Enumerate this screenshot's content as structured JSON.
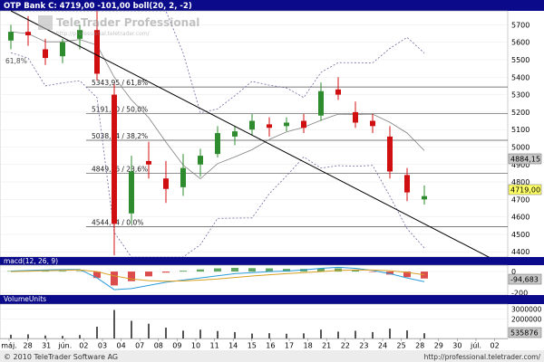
{
  "header": {
    "price_title": "OTP Bank C: 4719,00 -101,00 boll(20, 2, -2)",
    "macd_title": "macd(12, 26, 9)",
    "volume_title": "VolumeUnits"
  },
  "watermark": {
    "brand": "TeleTrader Professional",
    "url": "http://professional.teletrader.com/"
  },
  "footer": {
    "copyright": "© 2010 TeleTrader Software AG",
    "url": "http://professional.teletrader.com/"
  },
  "badges": {
    "upper_band": "4884,15",
    "last_price": "4719,00",
    "macd_value": "-94,683",
    "volume_value": "535876"
  },
  "colors": {
    "up_candle": "#2e8b2e",
    "down_candle": "#d01010",
    "band": "#6a6aa0",
    "ma": "#808080",
    "fib": "#505050",
    "trend": "#000000",
    "header_bg": "#0a0a8a",
    "macd_line": "#2a9bd8",
    "signal_line": "#d8a020",
    "macd_hist_pos": "#2e8b2e",
    "macd_hist_neg": "#d01010",
    "last_badge": "#ffff66",
    "upper_badge": "#c8c8c8"
  },
  "chart_data": {
    "type": "candlestick",
    "instrument": "OTP Bank C",
    "last": 4719.0,
    "change": -101.0,
    "ylim": [
      4370,
      5780
    ],
    "y_ticks": [
      4400,
      4500,
      4600,
      4700,
      4800,
      4900,
      5000,
      5100,
      5200,
      5300,
      5400,
      5500,
      5600,
      5700
    ],
    "x_ticks": [
      "máj.",
      "28",
      "31",
      "jún.",
      "02",
      "03",
      "04",
      "07",
      "08",
      "09",
      "10",
      "11",
      "14",
      "15",
      "16",
      "17",
      "18",
      "21",
      "22",
      "23",
      "24",
      "25",
      "28",
      "29",
      "30",
      "júl.",
      "02"
    ],
    "fib_levels": [
      {
        "value": 5343.95,
        "label": "5343,95 / 61,8%"
      },
      {
        "value": 5191.3,
        "label": "5191,30 / 50,0%"
      },
      {
        "value": 5038.64,
        "label": "5038,64 / 38,2%"
      },
      {
        "value": 4849.76,
        "label": "4849,76 / 23,6%"
      },
      {
        "value": 4544.44,
        "label": "4544,44 / 0,0%"
      }
    ],
    "fib_top_label": "61,8%",
    "trendline": {
      "x_start": 0,
      "y_start": 5780,
      "x_end": 24,
      "y_end": 4560
    },
    "candles": [
      {
        "day": 0,
        "open": 5610,
        "high": 5700,
        "low": 5560,
        "close": 5660
      },
      {
        "day": 1,
        "open": 5660,
        "high": 5750,
        "low": 5580,
        "close": 5640
      },
      {
        "day": 2,
        "open": 5560,
        "high": 5620,
        "low": 5470,
        "close": 5510
      },
      {
        "day": 3,
        "open": 5520,
        "high": 5620,
        "low": 5480,
        "close": 5600
      },
      {
        "day": 4,
        "open": 5620,
        "high": 5700,
        "low": 5560,
        "close": 5670
      },
      {
        "day": 5,
        "open": 5670,
        "high": 5780,
        "low": 5380,
        "close": 5420
      },
      {
        "day": 6,
        "open": 5300,
        "high": 5360,
        "low": 4380,
        "close": 4560
      },
      {
        "day": 7,
        "open": 4620,
        "high": 4950,
        "low": 4560,
        "close": 4860
      },
      {
        "day": 8,
        "open": 4920,
        "high": 5030,
        "low": 4820,
        "close": 4900
      },
      {
        "day": 9,
        "open": 4820,
        "high": 4920,
        "low": 4680,
        "close": 4760
      },
      {
        "day": 10,
        "open": 4770,
        "high": 4960,
        "low": 4720,
        "close": 4880
      },
      {
        "day": 11,
        "open": 4900,
        "high": 4990,
        "low": 4830,
        "close": 4950
      },
      {
        "day": 12,
        "open": 4960,
        "high": 5120,
        "low": 4940,
        "close": 5080
      },
      {
        "day": 13,
        "open": 5060,
        "high": 5120,
        "low": 5010,
        "close": 5090
      },
      {
        "day": 14,
        "open": 5100,
        "high": 5190,
        "low": 5070,
        "close": 5150
      },
      {
        "day": 15,
        "open": 5130,
        "high": 5170,
        "low": 5060,
        "close": 5110
      },
      {
        "day": 16,
        "open": 5120,
        "high": 5170,
        "low": 5090,
        "close": 5140
      },
      {
        "day": 17,
        "open": 5150,
        "high": 5190,
        "low": 5080,
        "close": 5110
      },
      {
        "day": 18,
        "open": 5180,
        "high": 5370,
        "low": 5150,
        "close": 5320
      },
      {
        "day": 19,
        "open": 5330,
        "high": 5400,
        "low": 5270,
        "close": 5300
      },
      {
        "day": 20,
        "open": 5200,
        "high": 5260,
        "low": 5110,
        "close": 5140
      },
      {
        "day": 21,
        "open": 5150,
        "high": 5190,
        "low": 5080,
        "close": 5120
      },
      {
        "day": 22,
        "open": 5060,
        "high": 5120,
        "low": 4820,
        "close": 4860
      },
      {
        "day": 23,
        "open": 4840,
        "high": 4880,
        "low": 4690,
        "close": 4740
      },
      {
        "day": 24,
        "open": 4700,
        "high": 4780,
        "low": 4670,
        "close": 4719
      }
    ],
    "macd": {
      "ylim": [
        -220,
        60
      ],
      "y_ticks": [
        0,
        -200
      ],
      "macd_line": [
        5,
        10,
        15,
        18,
        20,
        -60,
        -170,
        -160,
        -130,
        -100,
        -80,
        -60,
        -40,
        -20,
        -10,
        0,
        5,
        15,
        30,
        40,
        30,
        10,
        -20,
        -60,
        -95
      ],
      "signal_line": [
        0,
        4,
        8,
        12,
        15,
        0,
        -40,
        -70,
        -85,
        -90,
        -88,
        -80,
        -70,
        -55,
        -42,
        -30,
        -20,
        -10,
        0,
        10,
        15,
        14,
        8,
        -8,
        -30
      ],
      "histogram": [
        5,
        6,
        7,
        6,
        5,
        -60,
        -130,
        -90,
        -45,
        -10,
        8,
        20,
        30,
        35,
        32,
        30,
        25,
        25,
        30,
        30,
        15,
        -4,
        -28,
        -52,
        -65
      ]
    },
    "volume": {
      "ylim": [
        0,
        3500000
      ],
      "y_ticks": [
        3000000,
        2000000
      ],
      "y_tick_labels": [
        "3000000",
        "2000000"
      ],
      "values": [
        380000,
        420000,
        300000,
        260000,
        350000,
        1200000,
        2900000,
        1800000,
        1500000,
        1100000,
        800000,
        900000,
        760000,
        650000,
        500000,
        540000,
        480000,
        520000,
        900000,
        700000,
        780000,
        650000,
        1000000,
        820000,
        535876
      ]
    }
  }
}
